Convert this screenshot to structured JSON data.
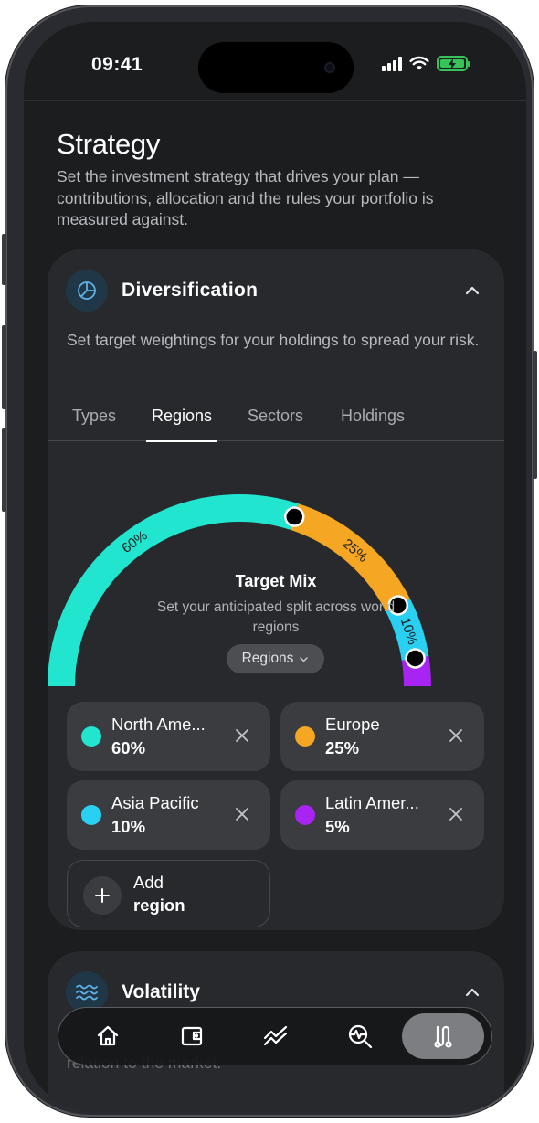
{
  "status_bar": {
    "time": "09:41"
  },
  "page": {
    "title": "Strategy",
    "description": "Set the investment strategy that drives your plan — contributions, allocation and the rules your portfolio is measured against."
  },
  "diversification": {
    "title": "Diversification",
    "description": "Set target weightings for your holdings to spread your risk.",
    "icon": "pie-chart-icon",
    "tabs": [
      "Types",
      "Regions",
      "Sectors",
      "Holdings"
    ],
    "active_tab": "Regions",
    "target_mix": {
      "title": "Target Mix",
      "subtitle": "Set your anticipated split across world regions",
      "selector_label": "Regions"
    },
    "regions": [
      {
        "name": "North Ame...",
        "percent": 60,
        "percent_label": "60%",
        "color": "#22e5cf"
      },
      {
        "name": "Europe",
        "percent": 25,
        "percent_label": "25%",
        "color": "#f5a623"
      },
      {
        "name": "Asia Pacific",
        "percent": 10,
        "percent_label": "10%",
        "color": "#2ad0f2"
      },
      {
        "name": "Latin Amer...",
        "percent": 5,
        "percent_label": "5%",
        "color": "#a724f2"
      }
    ],
    "add_button": {
      "line1": "Add",
      "line2": "region"
    }
  },
  "volatility": {
    "title": "Volatility",
    "description": "relation to the market.",
    "icon": "waves-icon"
  },
  "nav": {
    "items": [
      {
        "id": "home",
        "icon": "home-icon"
      },
      {
        "id": "wallet",
        "icon": "wallet-icon"
      },
      {
        "id": "performance",
        "icon": "trend-lines-icon"
      },
      {
        "id": "analysis",
        "icon": "search-pulse-icon"
      },
      {
        "id": "strategy",
        "icon": "route-icon",
        "active": true
      }
    ]
  }
}
